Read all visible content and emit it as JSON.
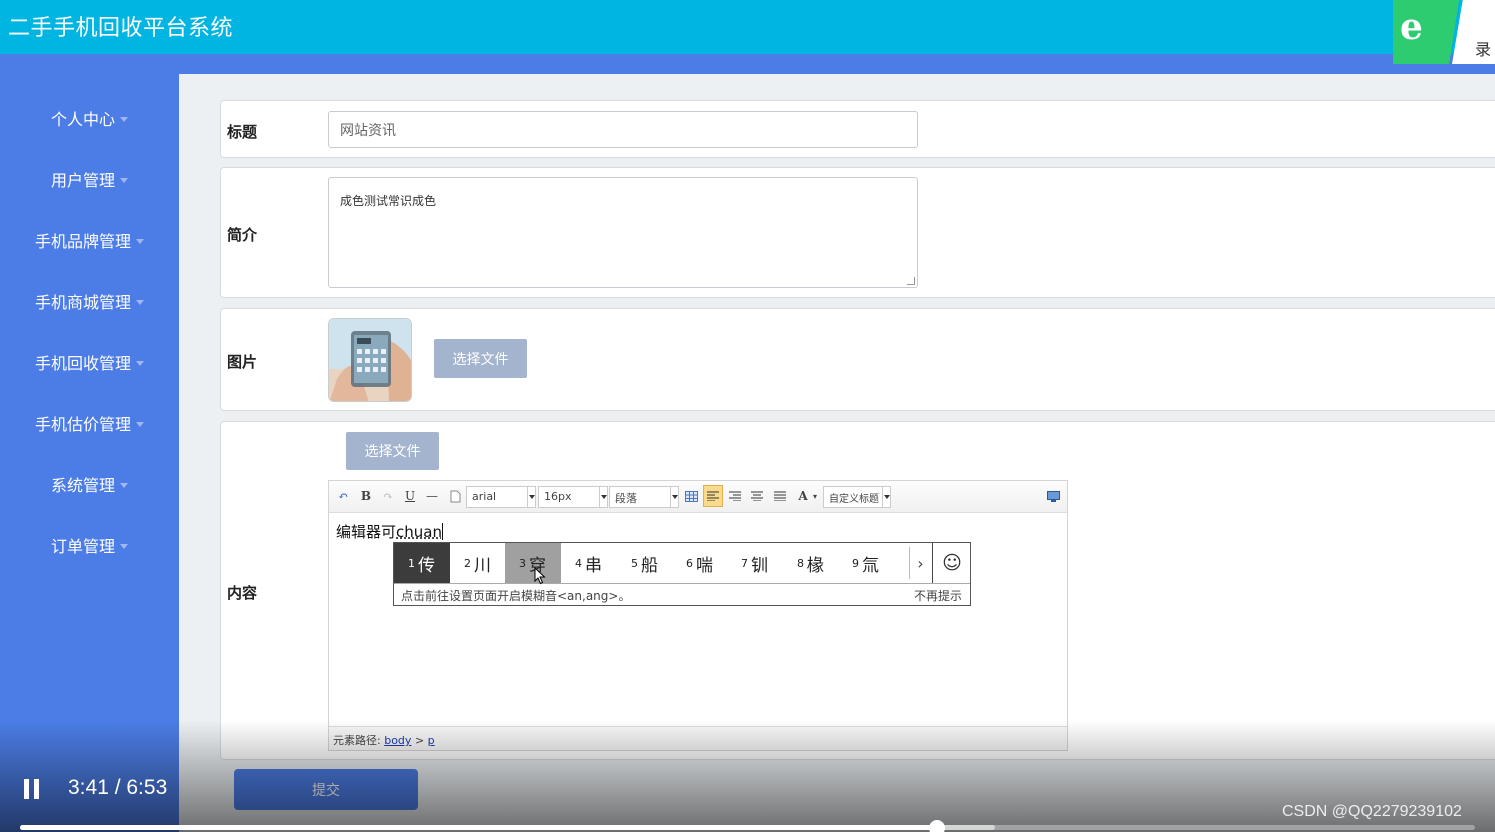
{
  "header": {
    "title": "二手手机回收平台系统",
    "user_tab": "录"
  },
  "sidebar": {
    "items": [
      {
        "label": "个人中心"
      },
      {
        "label": "用户管理"
      },
      {
        "label": "手机品牌管理"
      },
      {
        "label": "手机商城管理"
      },
      {
        "label": "手机回收管理"
      },
      {
        "label": "手机估价管理"
      },
      {
        "label": "系统管理"
      },
      {
        "label": "订单管理"
      }
    ]
  },
  "form": {
    "title_label": "标题",
    "title_value": "网站资讯",
    "intro_label": "简介",
    "intro_value": "成色测试常识成色",
    "image_label": "图片",
    "file_button": "选择文件",
    "content_label": "内容",
    "content_file_button": "选择文件",
    "submit": "提交"
  },
  "editor": {
    "font_family": "arial",
    "font_size": "16px",
    "paragraph": "段落",
    "custom_title": "自定义标题",
    "text_before": "编辑器可",
    "text_typed": "chuan",
    "path_label": "元素路径:",
    "path_body": "body",
    "path_sep": ">",
    "path_p": "p"
  },
  "ime": {
    "candidates": [
      {
        "num": "1",
        "text": "传"
      },
      {
        "num": "2",
        "text": "川"
      },
      {
        "num": "3",
        "text": "穿"
      },
      {
        "num": "4",
        "text": "串"
      },
      {
        "num": "5",
        "text": "船"
      },
      {
        "num": "6",
        "text": "喘"
      },
      {
        "num": "7",
        "text": "钏"
      },
      {
        "num": "8",
        "text": "椽"
      },
      {
        "num": "9",
        "text": "氚"
      }
    ],
    "tip": "点击前往设置页面开启模糊音<an,ang>。",
    "dismiss": "不再提示"
  },
  "video": {
    "time": "3:41 / 6:53",
    "progress": 0.63,
    "buffered": 0.67,
    "watermark": "CSDN @QQ2279239102"
  }
}
